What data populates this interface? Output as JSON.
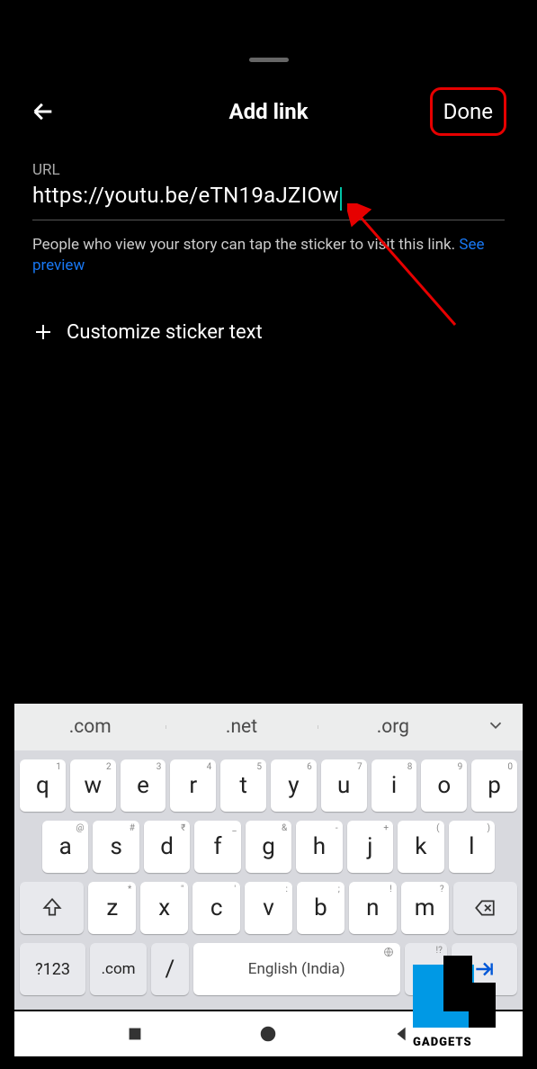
{
  "header": {
    "title": "Add link",
    "done": "Done"
  },
  "url": {
    "label": "URL",
    "value": "https://youtu.be/eTN19aJZIOw"
  },
  "helper": {
    "text": "People who view your story can tap the sticker to visit this link. ",
    "link": "See preview"
  },
  "customize": {
    "label": "Customize sticker text"
  },
  "suggestions": [
    ".com",
    ".net",
    ".org"
  ],
  "keyboard": {
    "row1": [
      {
        "main": "q",
        "sup": "1"
      },
      {
        "main": "w",
        "sup": "2"
      },
      {
        "main": "e",
        "sup": "3"
      },
      {
        "main": "r",
        "sup": "4"
      },
      {
        "main": "t",
        "sup": "5"
      },
      {
        "main": "y",
        "sup": "6"
      },
      {
        "main": "u",
        "sup": "7"
      },
      {
        "main": "i",
        "sup": "8"
      },
      {
        "main": "o",
        "sup": "9"
      },
      {
        "main": "p",
        "sup": "0"
      }
    ],
    "row2": [
      {
        "main": "a",
        "sup": "@"
      },
      {
        "main": "s",
        "sup": "#"
      },
      {
        "main": "d",
        "sup": "₹"
      },
      {
        "main": "f",
        "sup": "_"
      },
      {
        "main": "g",
        "sup": "&"
      },
      {
        "main": "h",
        "sup": "-"
      },
      {
        "main": "j",
        "sup": "+"
      },
      {
        "main": "k",
        "sup": "("
      },
      {
        "main": "l",
        "sup": ")"
      }
    ],
    "row3": [
      {
        "main": "z",
        "sup": "*"
      },
      {
        "main": "x",
        "sup": "\""
      },
      {
        "main": "c",
        "sup": "'"
      },
      {
        "main": "v",
        "sup": ":"
      },
      {
        "main": "b",
        "sup": ";"
      },
      {
        "main": "n",
        "sup": "!"
      },
      {
        "main": "m",
        "sup": "?"
      }
    ],
    "sym": "?123",
    "com": ".com",
    "slash": "/",
    "space": "English (India)",
    "period": ".",
    "period_sup": "!?"
  },
  "watermark": "GADGETS"
}
